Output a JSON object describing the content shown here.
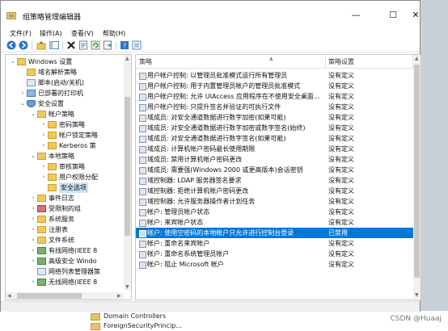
{
  "window": {
    "title": "组策略管理编辑器",
    "controls": {
      "minimize": "—",
      "maximize": "☐",
      "close": "✕"
    }
  },
  "menu": [
    "文件(F)",
    "操作(A)",
    "查看(V)",
    "帮助(H)"
  ],
  "toolbar": [
    "back-icon",
    "forward-icon",
    "up-folder-icon",
    "show-hide-tree-icon",
    "delete-icon",
    "properties-icon",
    "refresh-icon",
    "export-list-icon",
    "help-icon",
    "extended-view-icon"
  ],
  "tree": [
    {
      "label": "Windows 设置",
      "level": 1,
      "toggle": "⌄",
      "icon": "folder"
    },
    {
      "label": "域名解析策略",
      "level": 2,
      "toggle": "",
      "icon": "folder"
    },
    {
      "label": "脚本(启动/关机)",
      "level": 2,
      "toggle": "",
      "icon": "doc"
    },
    {
      "label": "已部署的打印机",
      "level": 2,
      "toggle": "›",
      "icon": "comp"
    },
    {
      "label": "安全设置",
      "level": 2,
      "toggle": "⌄",
      "icon": "shield"
    },
    {
      "label": "帐户策略",
      "level": 3,
      "toggle": "⌄",
      "icon": "folder"
    },
    {
      "label": "密码策略",
      "level": 4,
      "toggle": "›",
      "icon": "folder"
    },
    {
      "label": "帐户锁定策略",
      "level": 4,
      "toggle": "›",
      "icon": "folder"
    },
    {
      "label": "Kerberos 策",
      "level": 4,
      "toggle": "›",
      "icon": "folder"
    },
    {
      "label": "本地策略",
      "level": 3,
      "toggle": "⌄",
      "icon": "folder"
    },
    {
      "label": "审核策略",
      "level": 4,
      "toggle": "›",
      "icon": "folder"
    },
    {
      "label": "用户权限分配",
      "level": 4,
      "toggle": "›",
      "icon": "folder"
    },
    {
      "label": "安全选项",
      "level": 4,
      "toggle": "",
      "icon": "folder",
      "selected": true
    },
    {
      "label": "事件日志",
      "level": 3,
      "toggle": "›",
      "icon": "folder"
    },
    {
      "label": "受限制的组",
      "level": 3,
      "toggle": "›",
      "icon": "red"
    },
    {
      "label": "系统服务",
      "level": 3,
      "toggle": "›",
      "icon": "folder"
    },
    {
      "label": "注册表",
      "level": 3,
      "toggle": "›",
      "icon": "folder"
    },
    {
      "label": "文件系统",
      "level": 3,
      "toggle": "›",
      "icon": "folder"
    },
    {
      "label": "有线网络(IEEE 8",
      "level": 3,
      "toggle": "›",
      "icon": "green"
    },
    {
      "label": "高级安全 Windo",
      "level": 3,
      "toggle": "›",
      "icon": "green"
    },
    {
      "label": "网络列表管理器策",
      "level": 3,
      "toggle": "",
      "icon": "doc"
    },
    {
      "label": "无线网络(IEEE 8",
      "level": 3,
      "toggle": "›",
      "icon": "green"
    }
  ],
  "list": {
    "columns": {
      "policy": "策略",
      "setting": "策略设置"
    },
    "rows": [
      {
        "policy": "用户帐户控制: 以管理员批准模式运行所有管理员",
        "setting": "没有定义"
      },
      {
        "policy": "用户帐户控制: 用于内置管理员帐户的管理员批准模式",
        "setting": "没有定义"
      },
      {
        "policy": "用户帐户控制: 允许 UIAccess 应用程序在不使用安全桌面...",
        "setting": "没有定义"
      },
      {
        "policy": "用户帐户控制: 只提升签名并验证的可执行文件",
        "setting": "没有定义"
      },
      {
        "policy": "域成员: 对安全通道数据进行数字加密(如果可能)",
        "setting": "没有定义"
      },
      {
        "policy": "域成员: 对安全通道数据进行数字加密或数字签名(始终)",
        "setting": "没有定义"
      },
      {
        "policy": "域成员: 对安全通道数据进行数字签名(如果可能)",
        "setting": "没有定义"
      },
      {
        "policy": "域成员: 计算机帐户密码最长使用期限",
        "setting": "没有定义"
      },
      {
        "policy": "域成员: 禁用计算机帐户密码更改",
        "setting": "没有定义"
      },
      {
        "policy": "域成员: 需要强(Windows 2000 或更高版本)会话密钥",
        "setting": "没有定义"
      },
      {
        "policy": "域控制器: LDAP 服务器签名要求",
        "setting": "没有定义"
      },
      {
        "policy": "域控制器: 拒绝计算机帐户密码更改",
        "setting": "没有定义"
      },
      {
        "policy": "域控制器: 允许服务器操作者计划任务",
        "setting": "没有定义"
      },
      {
        "policy": "帐户: 管理员帐户状态",
        "setting": "没有定义"
      },
      {
        "policy": "帐户: 来宾帐户状态",
        "setting": "没有定义"
      },
      {
        "policy": "帐户: 使用空密码的本地帐户只允许进行控制台登录",
        "setting": "已禁用",
        "selected": true
      },
      {
        "policy": "帐户: 重命名来宾帐户",
        "setting": "没有定义"
      },
      {
        "policy": "帐户: 重命名系统管理员帐户",
        "setting": "没有定义"
      },
      {
        "policy": "帐户: 阻止 Microsoft 帐户",
        "setting": "没有定义"
      }
    ]
  },
  "background": {
    "items": [
      "Domain Controllers",
      "ForeignSecurityPrincip..."
    ],
    "watermark": "CSDN @Huaaj"
  }
}
